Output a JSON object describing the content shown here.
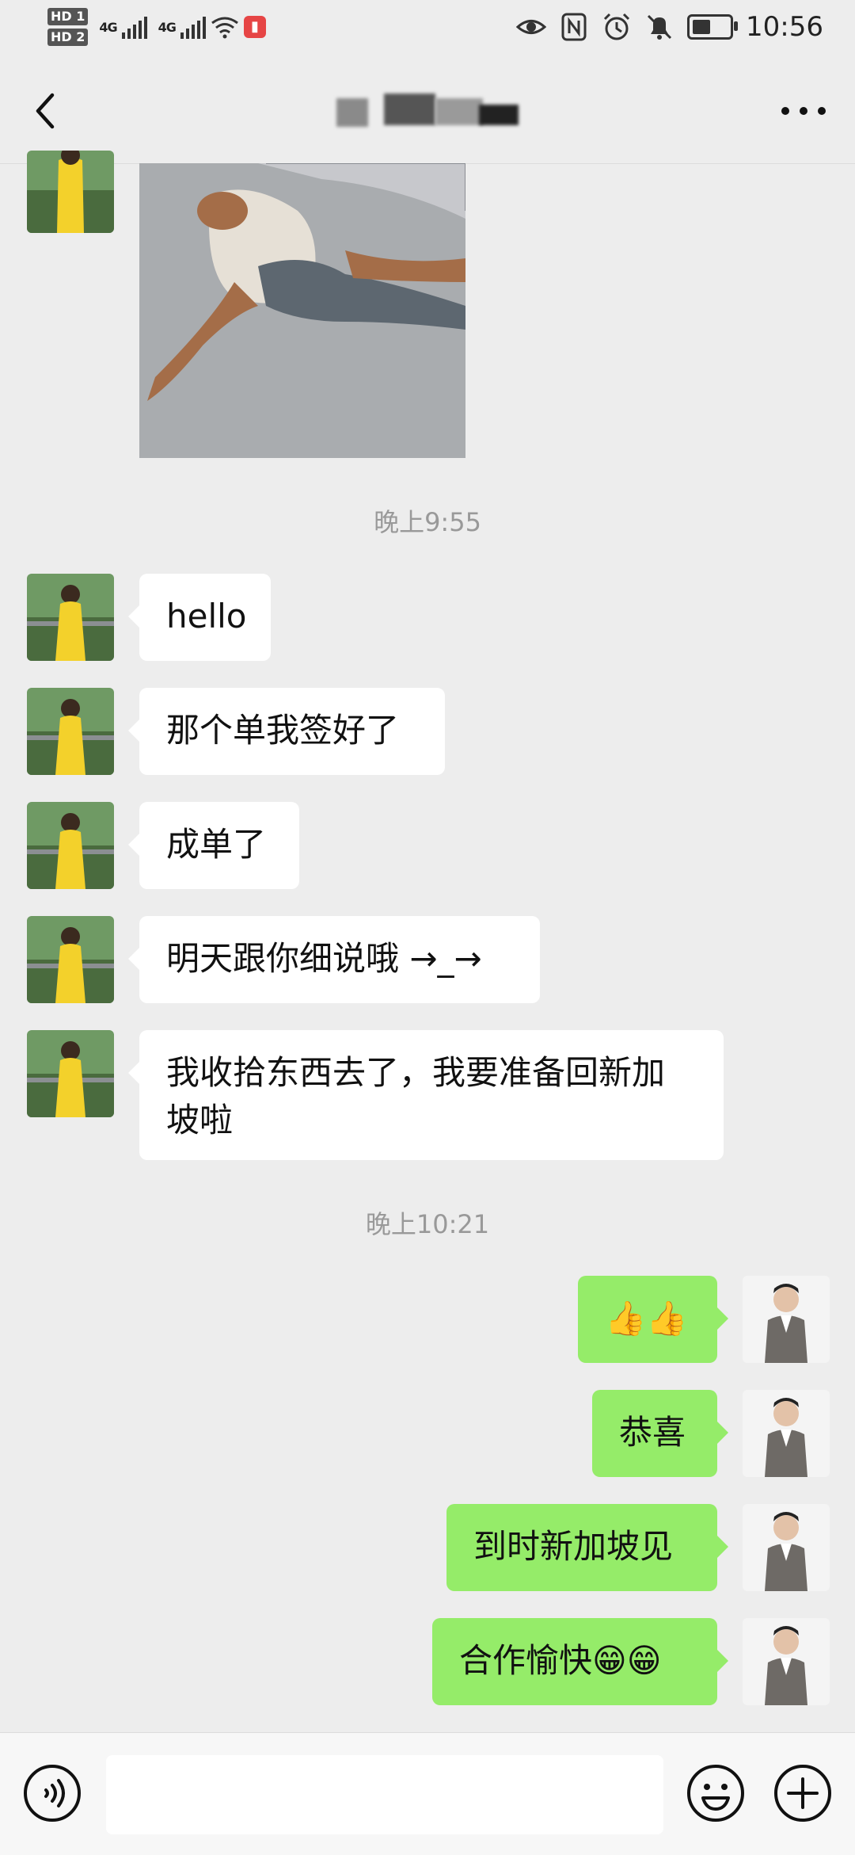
{
  "status_bar": {
    "sim1": "HD 1",
    "sim2": "HD 2",
    "net1": "4G",
    "net2": "4G",
    "time": "10:56"
  },
  "header": {
    "back_icon": "chevron-left-icon",
    "more_icon": "more-dots-icon"
  },
  "chat": {
    "timestamps": [
      "晚上9:55",
      "晚上10:21"
    ],
    "incoming": [
      {
        "text": "hello"
      },
      {
        "text": "那个单我签好了"
      },
      {
        "text": "成单了"
      },
      {
        "text": "明天跟你细说哦 →_→"
      },
      {
        "text": "我收拾东西去了，我要准备回新加坡啦"
      }
    ],
    "outgoing": [
      {
        "text": "👍👍",
        "emoji": "thumbs-up-icon"
      },
      {
        "text": "恭喜"
      },
      {
        "text": "到时新加坡见"
      },
      {
        "text": "合作愉快😁😁",
        "emoji": "grin-icon"
      }
    ]
  },
  "input_bar": {
    "voice_icon": "voice-icon",
    "emoji_icon": "emoji-icon",
    "plus_icon": "plus-icon",
    "placeholder": ""
  },
  "colors": {
    "background": "#ededed",
    "outgoing_bubble": "#95ec69",
    "incoming_bubble": "#ffffff"
  }
}
